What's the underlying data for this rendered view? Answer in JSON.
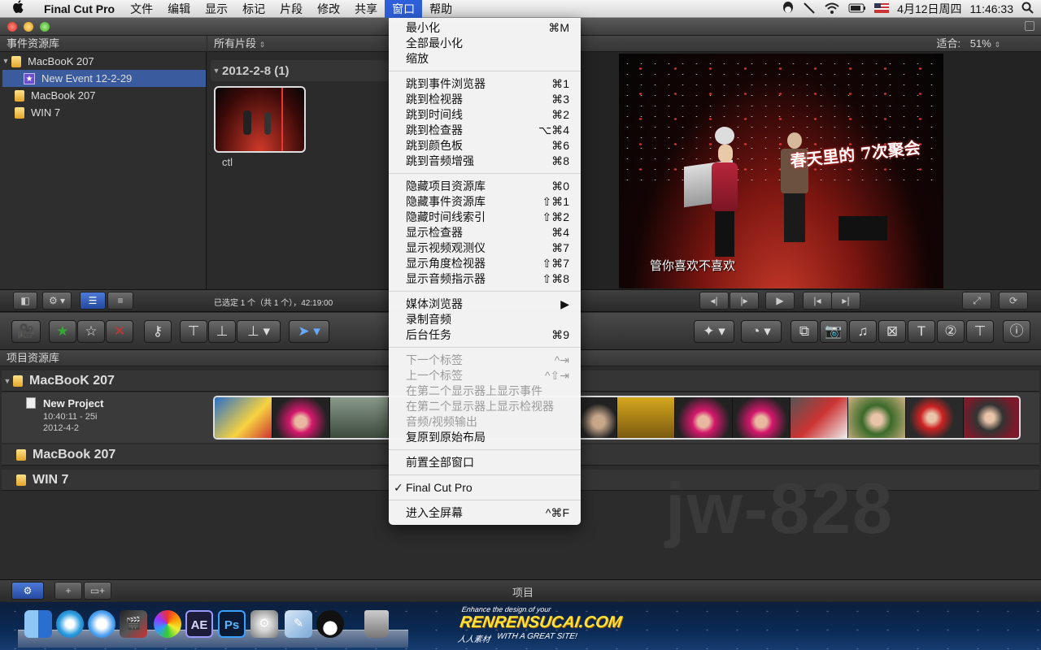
{
  "menubar": {
    "app_name": "Final Cut Pro",
    "items": [
      "文件",
      "编辑",
      "显示",
      "标记",
      "片段",
      "修改",
      "共享",
      "窗口",
      "帮助"
    ],
    "active_item": "窗口",
    "date": "4月12日周四",
    "time": "11:46:33"
  },
  "event_library": {
    "header": "事件资源库",
    "items": [
      {
        "label": "MacBooK 207",
        "type": "disk-locked"
      },
      {
        "label": "New Event 12-2-29",
        "type": "event",
        "selected": true
      },
      {
        "label": "MacBook 207",
        "type": "disk"
      },
      {
        "label": "WIN 7",
        "type": "disk"
      }
    ]
  },
  "browser": {
    "header": "所有片段",
    "group_label": "2012-2-8  (1)",
    "clip_name": "ctl",
    "selection_status": "已选定 1 个（共 1 个），42:19:00"
  },
  "viewer": {
    "fit_label": "适合:",
    "zoom": "51%",
    "subtitle": "管你喜欢不喜欢",
    "banner_text": "春天里的 7次聚会"
  },
  "window_menu": {
    "groups": [
      [
        {
          "label": "最小化",
          "shortcut": "⌘M"
        },
        {
          "label": "全部最小化",
          "shortcut": ""
        },
        {
          "label": "缩放",
          "shortcut": ""
        }
      ],
      [
        {
          "label": "跳到事件浏览器",
          "shortcut": "⌘1"
        },
        {
          "label": "跳到检视器",
          "shortcut": "⌘3"
        },
        {
          "label": "跳到时间线",
          "shortcut": "⌘2"
        },
        {
          "label": "跳到检查器",
          "shortcut": "⌥⌘4"
        },
        {
          "label": "跳到颜色板",
          "shortcut": "⌘6"
        },
        {
          "label": "跳到音频增强",
          "shortcut": "⌘8"
        }
      ],
      [
        {
          "label": "隐藏项目资源库",
          "shortcut": "⌘0"
        },
        {
          "label": "隐藏事件资源库",
          "shortcut": "⇧⌘1"
        },
        {
          "label": "隐藏时间线索引",
          "shortcut": "⇧⌘2"
        },
        {
          "label": "显示检查器",
          "shortcut": "⌘4"
        },
        {
          "label": "显示视频观测仪",
          "shortcut": "⌘7"
        },
        {
          "label": "显示角度检视器",
          "shortcut": "⇧⌘7"
        },
        {
          "label": "显示音频指示器",
          "shortcut": "⇧⌘8"
        }
      ],
      [
        {
          "label": "媒体浏览器",
          "shortcut": "▶"
        },
        {
          "label": "录制音频",
          "shortcut": ""
        },
        {
          "label": "后台任务",
          "shortcut": "⌘9"
        }
      ],
      [
        {
          "label": "下一个标签",
          "shortcut": "^⇥",
          "disabled": true
        },
        {
          "label": "上一个标签",
          "shortcut": "^⇧⇥",
          "disabled": true
        },
        {
          "label": "在第二个显示器上显示事件",
          "shortcut": "",
          "disabled": true
        },
        {
          "label": "在第二个显示器上显示检视器",
          "shortcut": "",
          "disabled": true
        },
        {
          "label": "音频/视频输出",
          "shortcut": "",
          "disabled": true
        },
        {
          "label": "复原到原始布局",
          "shortcut": ""
        }
      ],
      [
        {
          "label": "前置全部窗口",
          "shortcut": ""
        }
      ],
      [
        {
          "label": "Final Cut Pro",
          "shortcut": "",
          "checked": true
        }
      ],
      [
        {
          "label": "进入全屏幕",
          "shortcut": "^⌘F"
        }
      ]
    ]
  },
  "project_library": {
    "header": "项目资源库",
    "disk1": "MacBooK 207",
    "project_name": "New Project",
    "project_duration": "10:40:11 - 25i",
    "project_date": "2012-4-2",
    "disk2": "MacBook 207",
    "disk3": "WIN 7",
    "footer_label": "项目"
  },
  "watermark": "jw-828",
  "dock_watermark": {
    "top": "Enhance the design of your",
    "main": "RENRENSUCAI.COM",
    "sub": "人人素材",
    "tag": "WITH A GREAT SITE!"
  },
  "dock_icons": [
    "finder-icon",
    "safari-icon",
    "itunes-icon",
    "final-cut-icon",
    "photo-booth-icon",
    "after-effects-icon",
    "photoshop-icon",
    "system-preferences-icon",
    "preview-icon",
    "qq-icon",
    "trash-icon"
  ],
  "dock_labels": {
    "ae": "AE",
    "ps": "Ps"
  }
}
